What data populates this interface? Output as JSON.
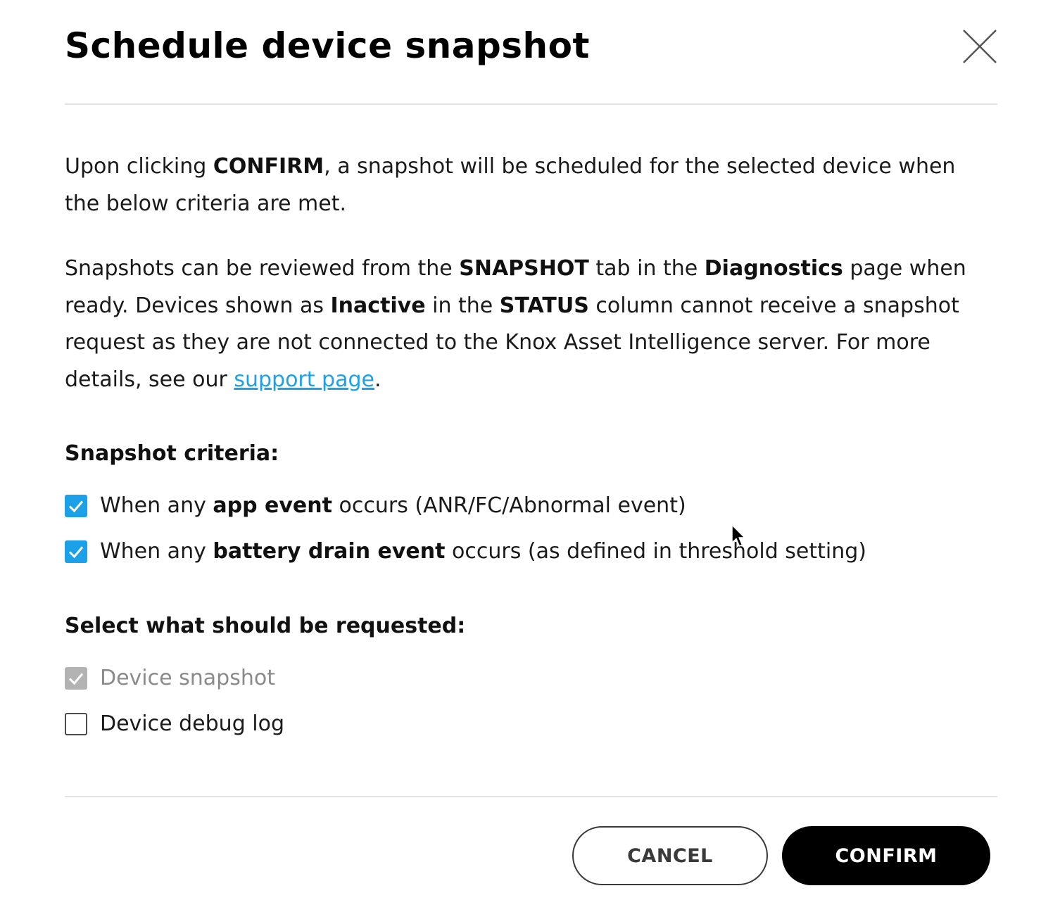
{
  "dialog": {
    "title": "Schedule device snapshot"
  },
  "intro": {
    "p1_a": "Upon clicking ",
    "p1_b": "CONFIRM",
    "p1_c": ", a snapshot will be scheduled for the selected device when the below criteria are met.",
    "p2_a": "Snapshots can be reviewed from the ",
    "p2_b": "SNAPSHOT",
    "p2_c": " tab in the ",
    "p2_d": "Diagnostics",
    "p2_e": " page when ready. Devices shown as ",
    "p2_f": "Inactive",
    "p2_g": " in the ",
    "p2_h": "STATUS",
    "p2_i": " column cannot receive a snapshot request as they are not connected to the Knox Asset Intelligence server. For more details, see our ",
    "p2_link": "support page",
    "p2_end": "."
  },
  "criteria": {
    "heading": "Snapshot criteria:",
    "items": [
      {
        "pre": "When any ",
        "bold": "app event",
        "post": " occurs (ANR/FC/Abnormal event)",
        "checked": true
      },
      {
        "pre": "When any ",
        "bold": "battery drain event",
        "post": " occurs (as defined in threshold setting)",
        "checked": true
      }
    ]
  },
  "request": {
    "heading": "Select what should be requested:",
    "items": [
      {
        "label": "Device snapshot",
        "checked": true,
        "disabled": true
      },
      {
        "label": "Device debug log",
        "checked": false,
        "disabled": false
      }
    ]
  },
  "footer": {
    "cancel_label": "CANCEL",
    "confirm_label": "CONFIRM"
  },
  "colors": {
    "accent": "#1ca1e8",
    "disabled_check": "#b3b3b3",
    "primary_button": "#000000"
  },
  "icons": {
    "close": "close-icon",
    "check": "checkmark-icon",
    "cursor": "mouse-pointer-icon"
  }
}
